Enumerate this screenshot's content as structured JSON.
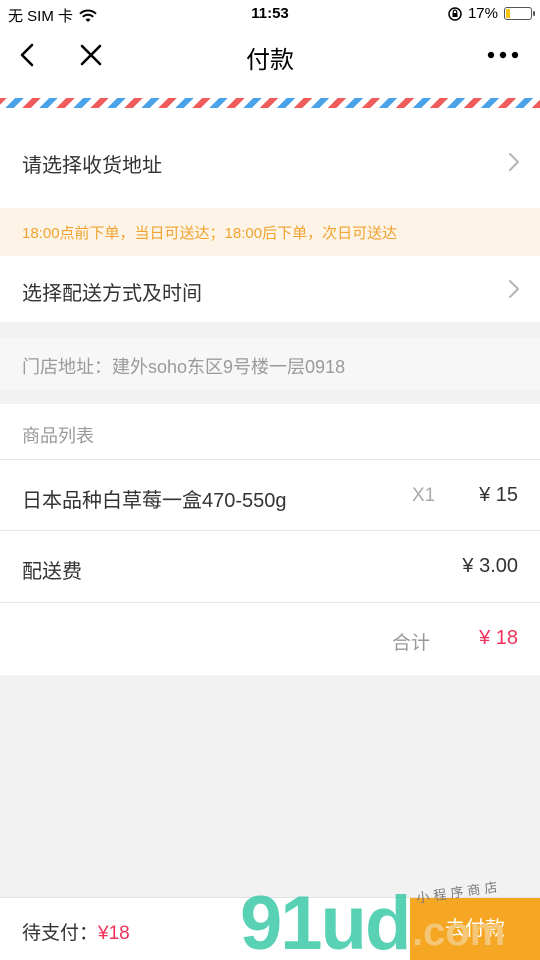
{
  "status_bar": {
    "carrier": "无 SIM 卡",
    "time": "11:53",
    "battery_percent": "17%",
    "battery_level": 0.17
  },
  "nav": {
    "title": "付款"
  },
  "address": {
    "label": "请选择收货地址"
  },
  "notice": {
    "text": "18:00点前下单，当日可送达；18:00后下单，次日可送达"
  },
  "delivery": {
    "label": "选择配送方式及时间"
  },
  "store": {
    "text": "门店地址：建外soho东区9号楼一层0918"
  },
  "goods": {
    "header": "商品列表",
    "items": [
      {
        "name": "日本品种白草莓一盒470-550g",
        "qty": "X1",
        "price": "¥ 15"
      }
    ]
  },
  "fee": {
    "label": "配送费",
    "value": "¥ 3.00"
  },
  "total": {
    "label": "合计",
    "value": "¥ 18"
  },
  "bottom": {
    "pending_label": "待支付：",
    "pending_amount": "¥18",
    "pay_button": "去付款"
  },
  "watermark": {
    "big": "91ud",
    "com": ".com",
    "tag": "小 程 序 商 店"
  },
  "colors": {
    "accent_orange": "#f5a623",
    "price_red": "#f0325a",
    "notice_text": "#f0a330",
    "stripe_red": "#f05b5b",
    "stripe_blue": "#4aa3e8"
  }
}
